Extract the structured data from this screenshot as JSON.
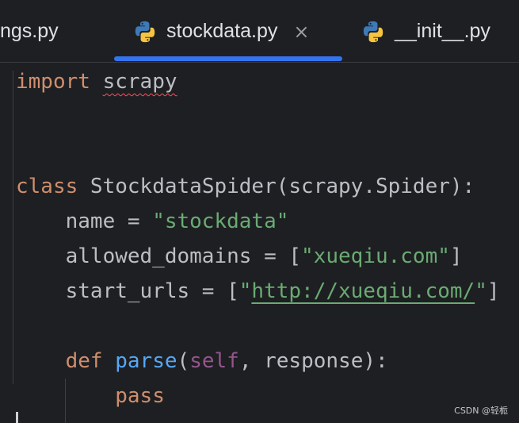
{
  "tabs": [
    {
      "label": "ngs.py"
    },
    {
      "label": "stockdata.py",
      "close": "×"
    },
    {
      "label": "__init__.py"
    }
  ],
  "code": {
    "l1": {
      "kw": "import",
      "name": "scrapy"
    },
    "l4": {
      "kw": "class",
      "rest": " StockdataSpider(scrapy.Spider):"
    },
    "l5": {
      "pre": "    name = ",
      "str": "\"stockdata\""
    },
    "l6": {
      "pre": "    allowed_domains = [",
      "str": "\"xueqiu.com\"",
      "post": "]"
    },
    "l7": {
      "pre": "    start_urls = [",
      "q1": "\"",
      "url": "http://xueqiu.com/",
      "q2": "\"",
      "post": "]"
    },
    "l9": {
      "indent": "    ",
      "kw": "def",
      "sp": " ",
      "fn": "parse",
      "p1": "(",
      "self": "self",
      "p2": ", response):"
    },
    "l10": {
      "indent": "        ",
      "kw": "pass"
    }
  },
  "watermark": "CSDN @轻栀",
  "colors": {
    "background": "#1e1f22",
    "keyword": "#cf8e6d",
    "string": "#6aab73",
    "function": "#56a8f5",
    "self": "#94558d",
    "accent": "#3574f0"
  }
}
